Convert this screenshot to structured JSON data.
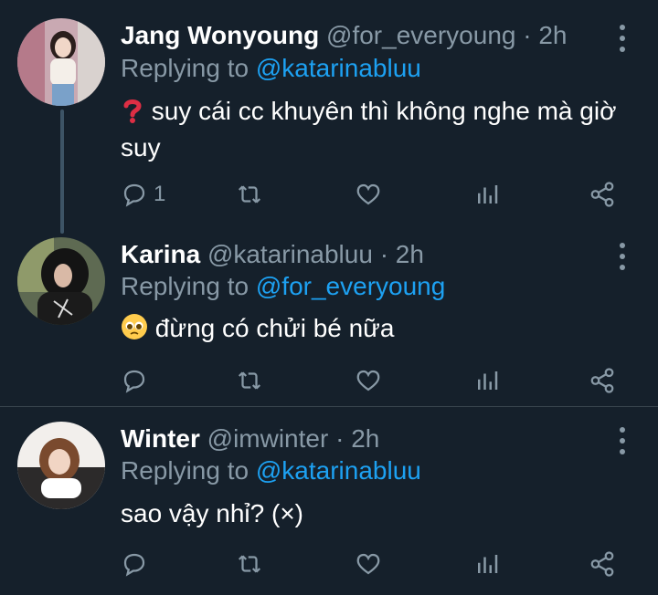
{
  "tweets": [
    {
      "name": "Jang Wonyoung",
      "handle": "@for_everyoung",
      "time": "· 2h",
      "replying_prefix": "Replying to",
      "replying_to": "@katarinabluu",
      "text": "suy cái cc khuyên thì không nghe mà giờ suy",
      "leading_emoji": "red-question-mark",
      "reply_count": "1"
    },
    {
      "name": "Karina",
      "handle": "@katarinabluu",
      "time": "· 2h",
      "replying_prefix": "Replying to",
      "replying_to": "@for_everyoung",
      "text": "đừng có chửi bé nữa",
      "leading_emoji": "pleading-face",
      "reply_count": ""
    },
    {
      "name": "Winter",
      "handle": "@imwinter",
      "time": "· 2h",
      "replying_prefix": "Replying to",
      "replying_to": "@katarinabluu",
      "text": "sao vậy nhỉ? (×)",
      "leading_emoji": "",
      "reply_count": ""
    }
  ],
  "colors": {
    "background": "#15202b",
    "secondary_text": "#8899a6",
    "mention": "#1da1f2",
    "divider": "#38444d"
  }
}
